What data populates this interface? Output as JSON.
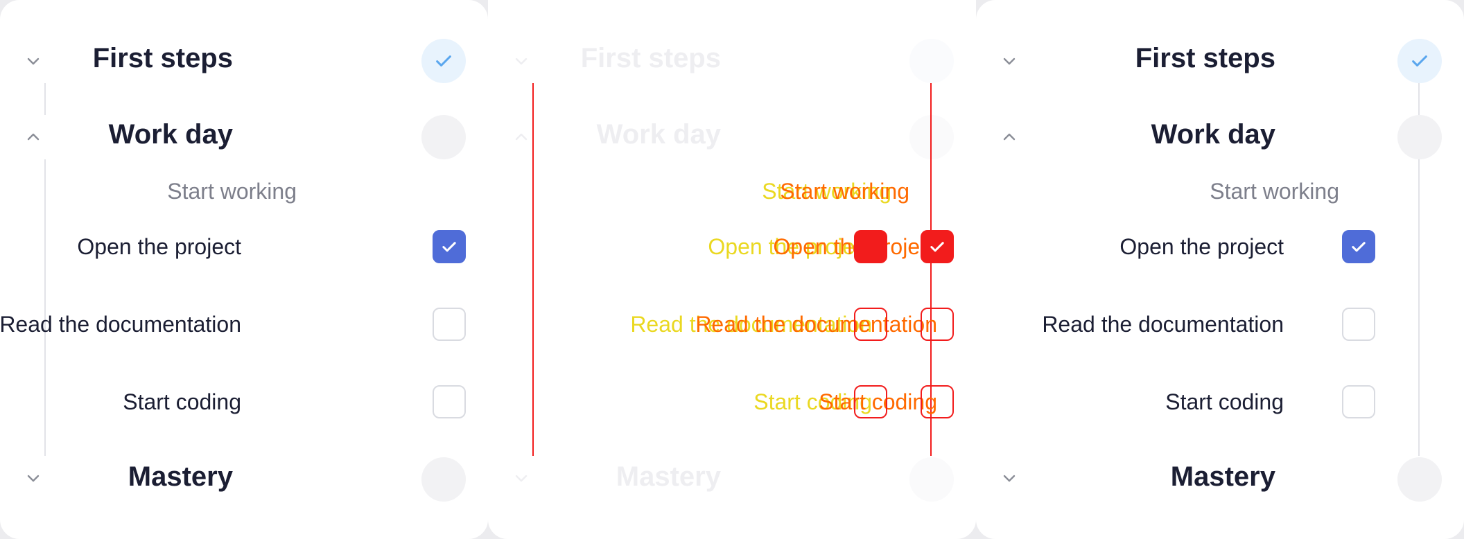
{
  "sections": {
    "first_steps": "First steps",
    "work_day": "Work day",
    "mastery": "Mastery"
  },
  "group": "Start working",
  "tasks": [
    {
      "label": "Open the project",
      "checked": true
    },
    {
      "label": "Read the documentation",
      "checked": false
    },
    {
      "label": "Start coding",
      "checked": false
    }
  ],
  "colors": {
    "accent": "#4f6cd8",
    "done_circle": "#e8f3fd",
    "check_light": "#5aa6ee",
    "ghost_red": "#f21c1c",
    "ghost_orange": "#ff6a00"
  },
  "icons": [
    "chevron-down-icon",
    "chevron-up-icon",
    "check-icon"
  ]
}
